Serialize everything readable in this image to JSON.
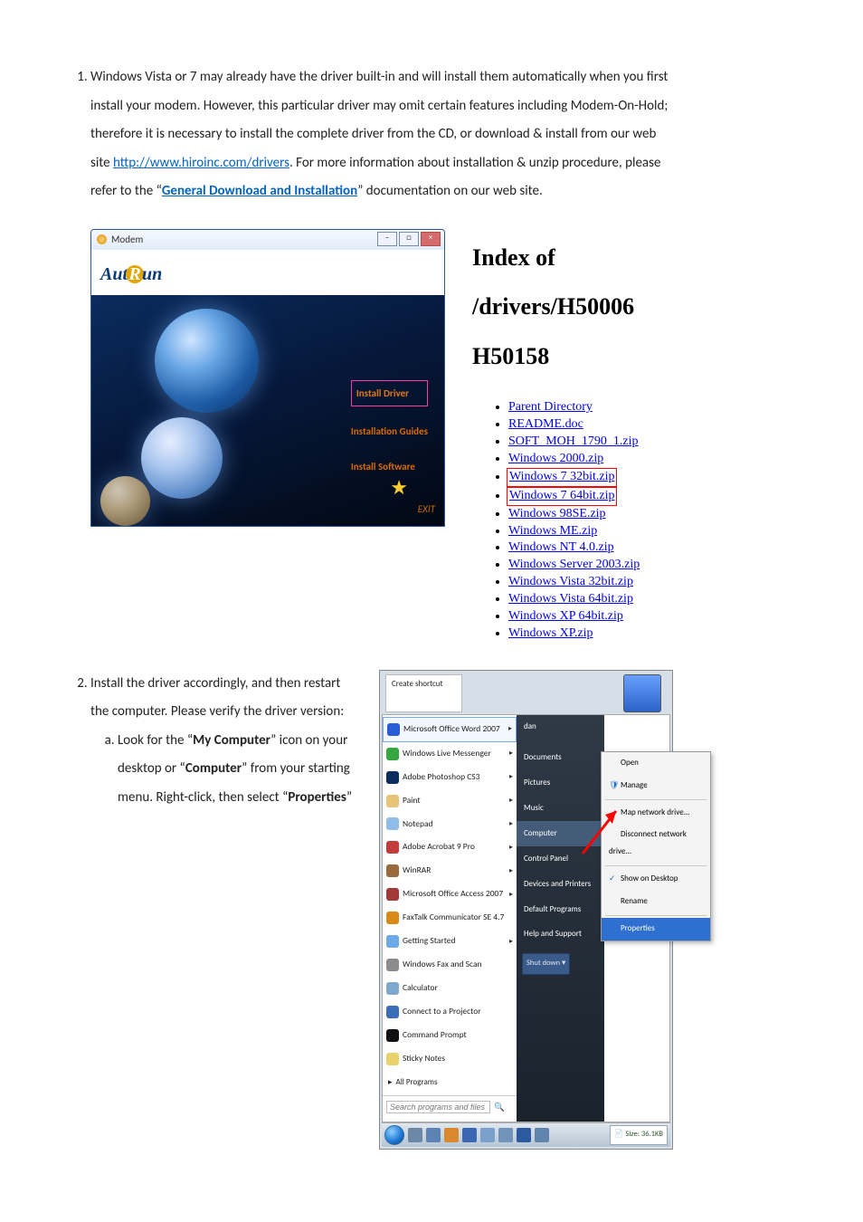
{
  "step1": {
    "text_parts": {
      "p1": "Windows Vista or 7 may already have the driver built-in and will install them automatically when you first install your modem.   However, this particular driver may omit certain features including Modem-On-Hold; therefore it is necessary to install the complete driver from the CD, or download & install from our web site ",
      "link1": "http://www.hiroinc.com/drivers",
      "p2": ".   For more information about installation & unzip procedure, please refer to the “",
      "link2": "General Download and Installation",
      "p3": "” documentation on our web site."
    }
  },
  "autorun": {
    "title": "Modem",
    "logo_a": "Aut",
    "logo_r": "R",
    "logo_b": "un",
    "menu": {
      "install_driver": "Install Driver",
      "installation_guides": "Installation Guides",
      "install_software": "Install Software"
    },
    "exit": "EXIT"
  },
  "indexof": {
    "heading": "Index of /drivers/H50006 H50158",
    "items": [
      "Parent Directory",
      "README.doc",
      "SOFT_MOH_1790_1.zip",
      "Windows 2000.zip",
      "Windows 7 32bit.zip",
      "Windows 7 64bit.zip",
      "Windows 98SE.zip",
      "Windows ME.zip",
      "Windows NT 4.0.zip",
      "Windows Server 2003.zip",
      "Windows Vista 32bit.zip",
      "Windows Vista 64bit.zip",
      "Windows XP 64bit.zip",
      "Windows XP.zip"
    ],
    "highlight_start": 4,
    "highlight_end": 5
  },
  "step2": {
    "intro_a": "Install the driver accordingly, and then restart the computer.   Please verify the driver version:",
    "sub_a_1": "Look for the “",
    "sub_a_bold1": "My Computer",
    "sub_a_2": "” icon on your desktop or “",
    "sub_a_bold2": "Computer",
    "sub_a_3": "” from your starting menu. Right-click, then select “",
    "sub_a_bold3": "Properties",
    "sub_a_4": "”"
  },
  "startmenu": {
    "create_shortcut": "Create shortcut",
    "user": "dan",
    "left_items": [
      {
        "label": "Microsoft Office Word 2007",
        "color": "#2a5bd7",
        "arrow": true,
        "boxed": true
      },
      {
        "label": "Windows Live Messenger",
        "color": "#36a641",
        "arrow": true
      },
      {
        "label": "Adobe Photoshop CS3",
        "color": "#0b2e5e",
        "arrow": true
      },
      {
        "label": "Paint",
        "color": "#e7c377",
        "arrow": true
      },
      {
        "label": "Notepad",
        "color": "#8fbce8",
        "arrow": true
      },
      {
        "label": "Adobe Acrobat 9 Pro",
        "color": "#c33b3b",
        "arrow": true
      },
      {
        "label": "WinRAR",
        "color": "#9b6a3c",
        "arrow": true
      },
      {
        "label": "Microsoft Office Access 2007",
        "color": "#a33a3a",
        "arrow": true
      },
      {
        "label": "FaxTalk Communicator SE 4.7",
        "color": "#d98b1a",
        "arrow": false
      },
      {
        "label": "Getting Started",
        "color": "#6fa8e8",
        "arrow": true
      },
      {
        "label": "Windows Fax and Scan",
        "color": "#8c8c8c",
        "arrow": false
      },
      {
        "label": "Calculator",
        "color": "#7fa8cf",
        "arrow": false
      },
      {
        "label": "Connect to a Projector",
        "color": "#3a6eb7",
        "arrow": false
      },
      {
        "label": "Command Prompt",
        "color": "#111111",
        "arrow": false
      },
      {
        "label": "Sticky Notes",
        "color": "#e8d36a",
        "arrow": false
      }
    ],
    "all_programs": "All Programs",
    "all_programs_arrow": "▸",
    "search_placeholder": "Search programs and files",
    "right_items": [
      "Documents",
      "Pictures",
      "Music",
      "Computer",
      "Control Panel",
      "Devices and Printers",
      "Default Programs",
      "Help and Support"
    ],
    "right_highlight_index": 3,
    "shutdown": "Shut down  ▾",
    "context_items": [
      {
        "label": "Open",
        "check": false
      },
      {
        "label": "Manage",
        "check": false,
        "icon": true
      },
      {
        "sep": true
      },
      {
        "label": "Map network drive...",
        "check": false
      },
      {
        "label": "Disconnect network drive...",
        "check": false
      },
      {
        "sep": true
      },
      {
        "label": "Show on Desktop",
        "check": true
      },
      {
        "label": "Rename",
        "check": false
      },
      {
        "sep": true
      },
      {
        "label": "Properties",
        "check": false,
        "hl": true
      }
    ],
    "size_label": "Size: 36.1KB"
  }
}
